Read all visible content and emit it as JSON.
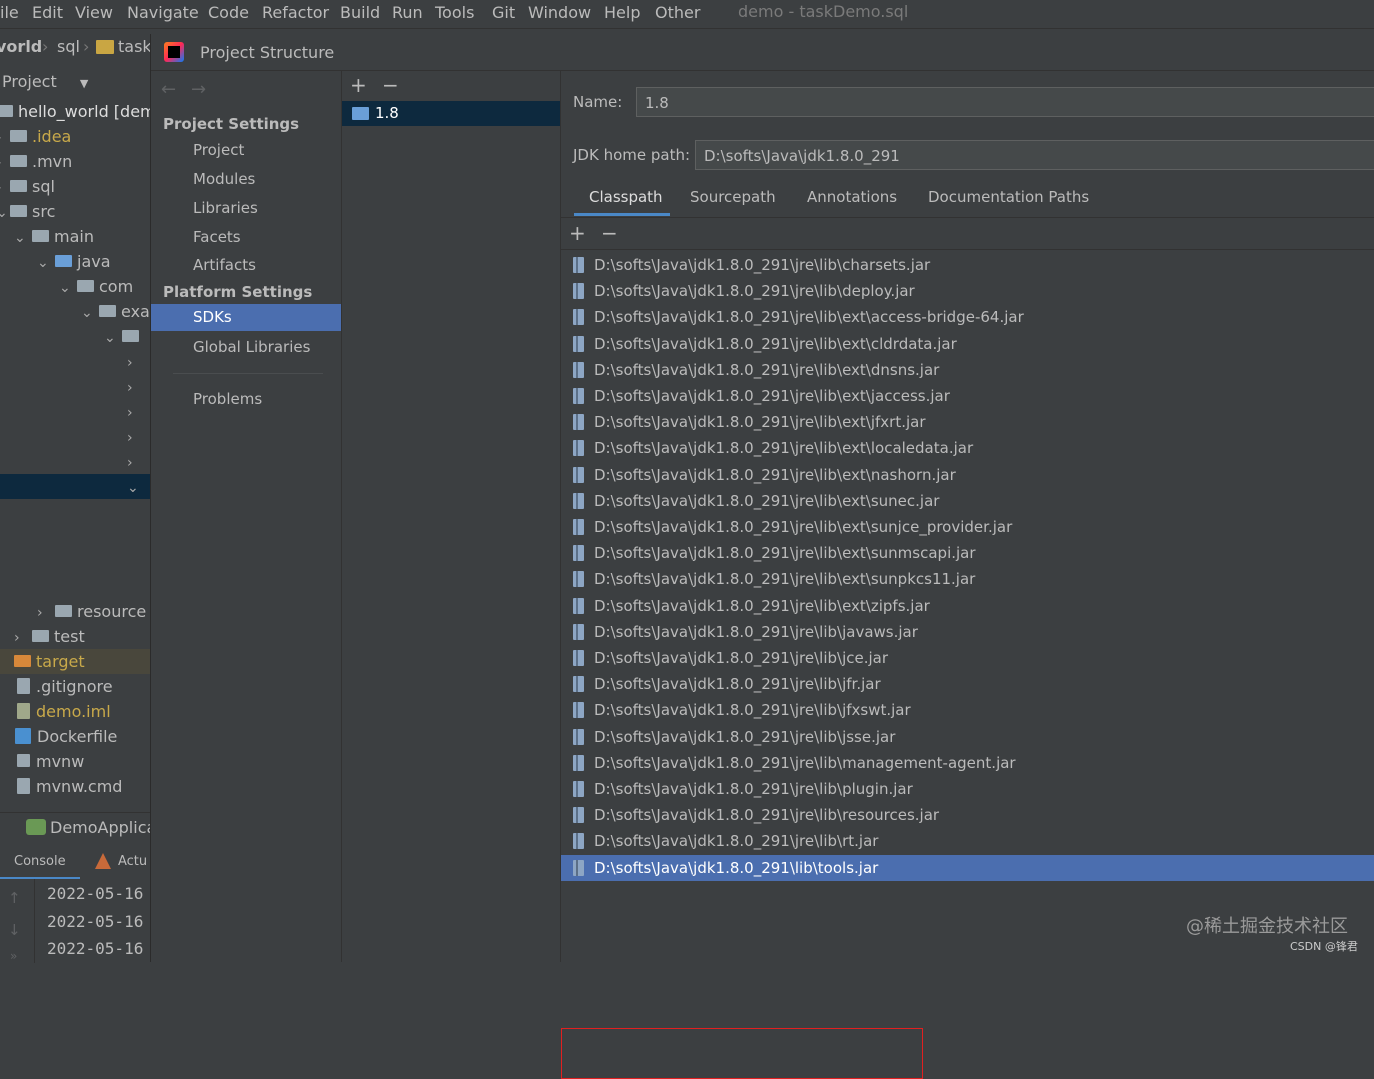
{
  "menubar": {
    "items": [
      "ile",
      "Edit",
      "View",
      "Navigate",
      "Code",
      "Refactor",
      "Build",
      "Run",
      "Tools",
      "Git",
      "Window",
      "Help",
      "Other"
    ],
    "window_title": "demo - taskDemo.sql"
  },
  "breadcrumb": [
    "vorld",
    "sql",
    "task"
  ],
  "project_panel": {
    "header": "Project",
    "root": "hello_world [demo",
    "rows": [
      ".idea",
      ".mvn",
      "sql",
      "src",
      "main",
      "java",
      "com",
      "exa"
    ],
    "rows_lower": [
      "resource",
      "test",
      "target",
      ".gitignore",
      "demo.iml",
      "Dockerfile",
      "mvnw",
      "mvnw.cmd"
    ]
  },
  "run_panel": {
    "config": "DemoApplica",
    "tabs": [
      "Console",
      "Actu"
    ],
    "lines": [
      "2022-05-16",
      "2022-05-16",
      "2022-05-16"
    ]
  },
  "dialog": {
    "title": "Project Structure",
    "nav": {
      "project_settings_heading": "Project Settings",
      "project_settings": [
        "Project",
        "Modules",
        "Libraries",
        "Facets",
        "Artifacts"
      ],
      "platform_settings_heading": "Platform Settings",
      "platform_settings": [
        "SDKs",
        "Global Libraries"
      ],
      "problems": "Problems",
      "selected": "SDKs"
    },
    "sdk_list": {
      "add_label": "+",
      "remove_label": "−",
      "items": [
        "1.8"
      ]
    },
    "detail": {
      "name_label": "Name:",
      "name_value": "1.8",
      "jdk_label": "JDK home path:",
      "jdk_value": "D:\\softs\\Java\\jdk1.8.0_291",
      "tabs": [
        "Classpath",
        "Sourcepath",
        "Annotations",
        "Documentation Paths"
      ],
      "active_tab": "Classpath",
      "classpath": [
        "D:\\softs\\Java\\jdk1.8.0_291\\jre\\lib\\charsets.jar",
        "D:\\softs\\Java\\jdk1.8.0_291\\jre\\lib\\deploy.jar",
        "D:\\softs\\Java\\jdk1.8.0_291\\jre\\lib\\ext\\access-bridge-64.jar",
        "D:\\softs\\Java\\jdk1.8.0_291\\jre\\lib\\ext\\cldrdata.jar",
        "D:\\softs\\Java\\jdk1.8.0_291\\jre\\lib\\ext\\dnsns.jar",
        "D:\\softs\\Java\\jdk1.8.0_291\\jre\\lib\\ext\\jaccess.jar",
        "D:\\softs\\Java\\jdk1.8.0_291\\jre\\lib\\ext\\jfxrt.jar",
        "D:\\softs\\Java\\jdk1.8.0_291\\jre\\lib\\ext\\localedata.jar",
        "D:\\softs\\Java\\jdk1.8.0_291\\jre\\lib\\ext\\nashorn.jar",
        "D:\\softs\\Java\\jdk1.8.0_291\\jre\\lib\\ext\\sunec.jar",
        "D:\\softs\\Java\\jdk1.8.0_291\\jre\\lib\\ext\\sunjce_provider.jar",
        "D:\\softs\\Java\\jdk1.8.0_291\\jre\\lib\\ext\\sunmscapi.jar",
        "D:\\softs\\Java\\jdk1.8.0_291\\jre\\lib\\ext\\sunpkcs11.jar",
        "D:\\softs\\Java\\jdk1.8.0_291\\jre\\lib\\ext\\zipfs.jar",
        "D:\\softs\\Java\\jdk1.8.0_291\\jre\\lib\\javaws.jar",
        "D:\\softs\\Java\\jdk1.8.0_291\\jre\\lib\\jce.jar",
        "D:\\softs\\Java\\jdk1.8.0_291\\jre\\lib\\jfr.jar",
        "D:\\softs\\Java\\jdk1.8.0_291\\jre\\lib\\jfxswt.jar",
        "D:\\softs\\Java\\jdk1.8.0_291\\jre\\lib\\jsse.jar",
        "D:\\softs\\Java\\jdk1.8.0_291\\jre\\lib\\management-agent.jar",
        "D:\\softs\\Java\\jdk1.8.0_291\\jre\\lib\\plugin.jar",
        "D:\\softs\\Java\\jdk1.8.0_291\\jre\\lib\\resources.jar",
        "D:\\softs\\Java\\jdk1.8.0_291\\jre\\lib\\rt.jar",
        "D:\\softs\\Java\\jdk1.8.0_291\\lib\\tools.jar"
      ],
      "selected_index": 23
    }
  },
  "watermark": "@稀土掘金技术社区",
  "credit": "CSDN @锋君",
  "colors": {
    "selection": "#4b6eaf",
    "background": "#3c3f41",
    "highlight_box": "#e02020"
  }
}
